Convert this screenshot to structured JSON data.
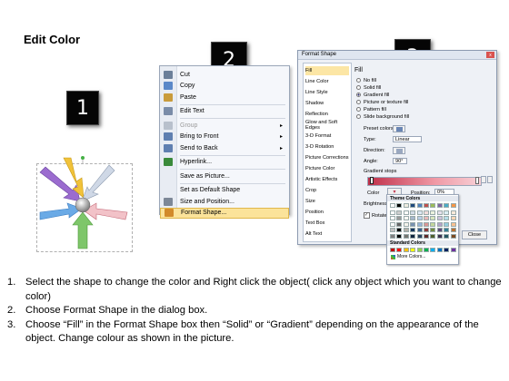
{
  "title": "Edit Color",
  "badges": [
    "1",
    "2",
    "3"
  ],
  "context_menu": {
    "items": [
      {
        "label": "Cut",
        "icon": "scissors-icon",
        "color": "#6b7f99",
        "arrow": false,
        "disabled": false
      },
      {
        "label": "Copy",
        "icon": "copy-icon",
        "color": "#5a88c8",
        "arrow": false,
        "disabled": false
      },
      {
        "label": "Paste",
        "icon": "paste-icon",
        "color": "#c99b3b",
        "arrow": false,
        "disabled": false
      },
      {
        "label": "Edit Text",
        "icon": "edit-text-icon",
        "color": "#7a8ca8",
        "arrow": false,
        "disabled": false,
        "sep_before": true
      },
      {
        "label": "Group",
        "icon": "group-icon",
        "color": "#b8c0cc",
        "arrow": true,
        "disabled": true,
        "sep_before": true
      },
      {
        "label": "Bring to Front",
        "icon": "bring-front-icon",
        "color": "#5f7fb0",
        "arrow": true,
        "disabled": false
      },
      {
        "label": "Send to Back",
        "icon": "send-back-icon",
        "color": "#5f7fb0",
        "arrow": true,
        "disabled": false
      },
      {
        "label": "Hyperlink...",
        "icon": "hyperlink-icon",
        "color": "#3a8a3a",
        "arrow": false,
        "disabled": false,
        "sep_before": true
      },
      {
        "label": "Save as Picture...",
        "icon": "",
        "color": "",
        "arrow": false,
        "disabled": false,
        "sep_before": true
      },
      {
        "label": "Set as Default Shape",
        "icon": "",
        "color": "",
        "arrow": false,
        "disabled": false,
        "sep_before": true
      },
      {
        "label": "Size and Position...",
        "icon": "size-position-icon",
        "color": "#7d8897",
        "arrow": false,
        "disabled": false
      },
      {
        "label": "Format Shape...",
        "icon": "format-shape-icon",
        "color": "#d28a2a",
        "arrow": false,
        "disabled": false,
        "highlighted": true
      }
    ]
  },
  "dialog": {
    "title": "Format Shape",
    "close": "x",
    "categories": [
      "Fill",
      "Line Color",
      "Line Style",
      "Shadow",
      "Reflection",
      "Glow and Soft Edges",
      "3-D Format",
      "3-D Rotation",
      "Picture Corrections",
      "Picture Color",
      "Artistic Effects",
      "Crop",
      "Size",
      "Position",
      "Text Box",
      "Alt Text"
    ],
    "selected_category": "Fill",
    "panel_title": "Fill",
    "fill_options": [
      {
        "label": "No fill",
        "selected": false
      },
      {
        "label": "Solid fill",
        "selected": false
      },
      {
        "label": "Gradient fill",
        "selected": true
      },
      {
        "label": "Picture or texture fill",
        "selected": false
      },
      {
        "label": "Pattern fill",
        "selected": false
      },
      {
        "label": "Slide background fill",
        "selected": false
      }
    ],
    "preset_colors_label": "Preset colors:",
    "type_label": "Type:",
    "type_value": "Linear",
    "direction_label": "Direction:",
    "angle_label": "Angle:",
    "angle_value": "90°",
    "gradient_stops_label": "Gradient stops",
    "color_label": "Color",
    "position_label": "Position:",
    "position_value": "0%",
    "brightness_label": "Brightness",
    "rotate_label": "Rotate w",
    "close_button": "Close"
  },
  "palette": {
    "theme_colors_label": "Theme Colors",
    "standard_colors_label": "Standard Colors",
    "more_colors": "More Colors...",
    "theme_top": [
      "#ffffff",
      "#000000",
      "#eeece1",
      "#1f497d",
      "#4f81bd",
      "#c0504d",
      "#9bbb59",
      "#8064a2",
      "#4bacc6",
      "#f79646"
    ],
    "standard": [
      "#c00000",
      "#ff0000",
      "#ffc000",
      "#ffff00",
      "#92d050",
      "#00b050",
      "#00b0f0",
      "#0070c0",
      "#002060",
      "#7030a0"
    ]
  },
  "instructions": [
    {
      "num": "1.",
      "text": "Select the shape to change the color and Right click the object( click any object which you want to change color)"
    },
    {
      "num": "2.",
      "text": "Choose Format Shape in the dialog box."
    },
    {
      "num": "3.",
      "text": "Choose “Fill” in the Format Shape box then “Solid” or “Gradient” depending on the appearance of the object. Change colour as shown in the picture."
    }
  ]
}
